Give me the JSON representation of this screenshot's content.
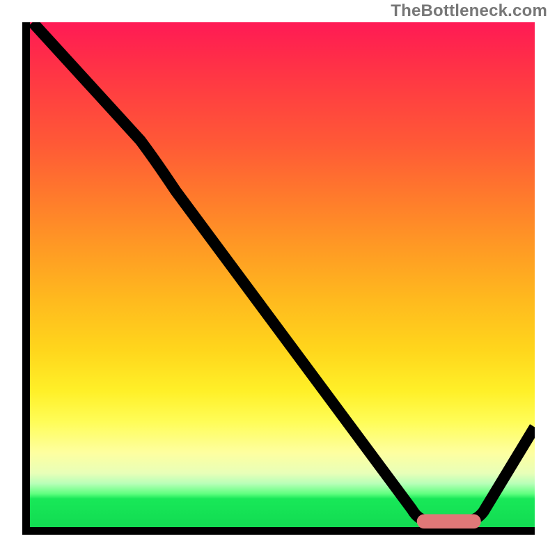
{
  "watermark": "TheBottleneck.com",
  "chart_data": {
    "type": "line",
    "title": "",
    "xlabel": "",
    "ylabel": "",
    "xlim": [
      0,
      100
    ],
    "ylim": [
      0,
      100
    ],
    "note": "Axes are unlabeled in the source image; x/y values below are normalized 0–100 from the plot area. y is plotted with 0 at top (higher curve = lower y value).",
    "series": [
      {
        "name": "bottleneck-curve",
        "x": [
          2,
          10,
          18,
          23,
          27,
          32,
          40,
          50,
          60,
          70,
          76,
          80,
          84,
          88,
          92,
          96,
          100
        ],
        "y": [
          0,
          9,
          18,
          23,
          28,
          35,
          46,
          59,
          72,
          85,
          95,
          97,
          97,
          97,
          93,
          86,
          79
        ]
      }
    ],
    "marker": {
      "name": "optimal-zone",
      "x_range": [
        77,
        89.5
      ],
      "y": 97,
      "color": "#e07878",
      "shape": "capsule"
    },
    "background_gradient": {
      "direction": "top-to-bottom",
      "stops": [
        {
          "pos": 0.0,
          "color": "#ff1a55"
        },
        {
          "pos": 0.24,
          "color": "#ff5a36"
        },
        {
          "pos": 0.54,
          "color": "#ffb91e"
        },
        {
          "pos": 0.78,
          "color": "#fffd58"
        },
        {
          "pos": 0.9,
          "color": "#b8ffb8"
        },
        {
          "pos": 0.93,
          "color": "#18e858"
        },
        {
          "pos": 1.0,
          "color": "#10d850"
        }
      ]
    }
  }
}
